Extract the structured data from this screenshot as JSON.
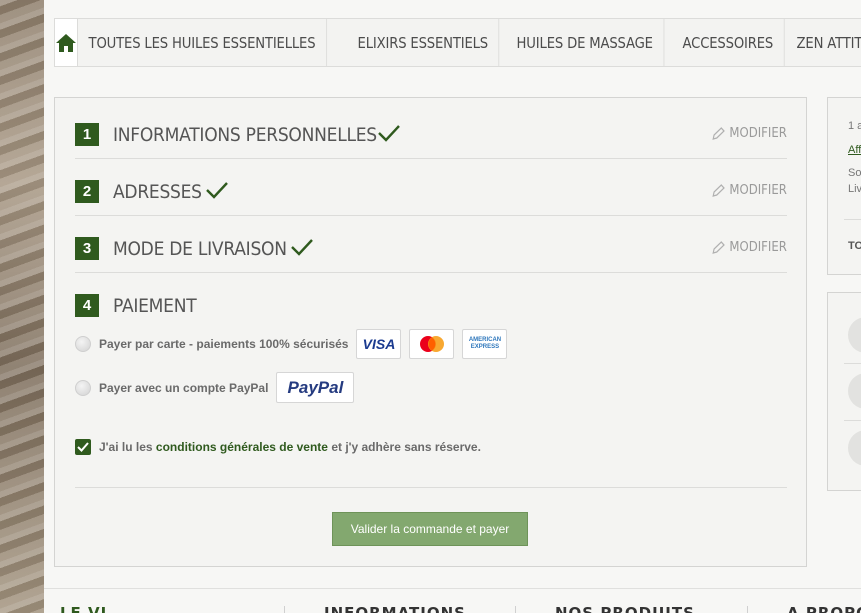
{
  "nav": {
    "items": [
      {
        "label": "TOUTES LES HUILES ESSENTIELLES"
      },
      {
        "label": "ELIXIRS ESSENTIELS"
      },
      {
        "label": "HUILES DE MASSAGE"
      },
      {
        "label": "ACCESSOIRES"
      },
      {
        "label": "ZEN ATTITUDE"
      }
    ]
  },
  "steps": [
    {
      "num": "1",
      "title": "INFORMATIONS PERSONNELLES",
      "modify": "MODIFIER"
    },
    {
      "num": "2",
      "title": "ADRESSES",
      "modify": "MODIFIER"
    },
    {
      "num": "3",
      "title": "MODE DE LIVRAISON",
      "modify": "MODIFIER"
    },
    {
      "num": "4",
      "title": "PAIEMENT"
    }
  ],
  "payment": {
    "card_label": "Payer par carte - paiements 100% sécurisés",
    "paypal_label": "Payer avec un compte PayPal",
    "visa": "VISA",
    "amex_line1": "AMERICAN",
    "amex_line2": "EXPRESS",
    "paypal_brand": "PayPal"
  },
  "terms": {
    "prefix": "J'ai lu les",
    "link": "conditions générales de vente",
    "suffix": "et j'y adhère sans réserve."
  },
  "submit_label": "Valider la commande et payer",
  "side": {
    "line1": "1 a",
    "link": "Aff",
    "line2": "So",
    "line3": "Liv",
    "total": "TO"
  },
  "footer": {
    "items": [
      "LE VI",
      "INFORMATIONS",
      "NOS PRODUITS",
      "A PROPO"
    ]
  },
  "colors": {
    "brand_green": "#2f5a1e",
    "button_green": "#83a86f"
  }
}
